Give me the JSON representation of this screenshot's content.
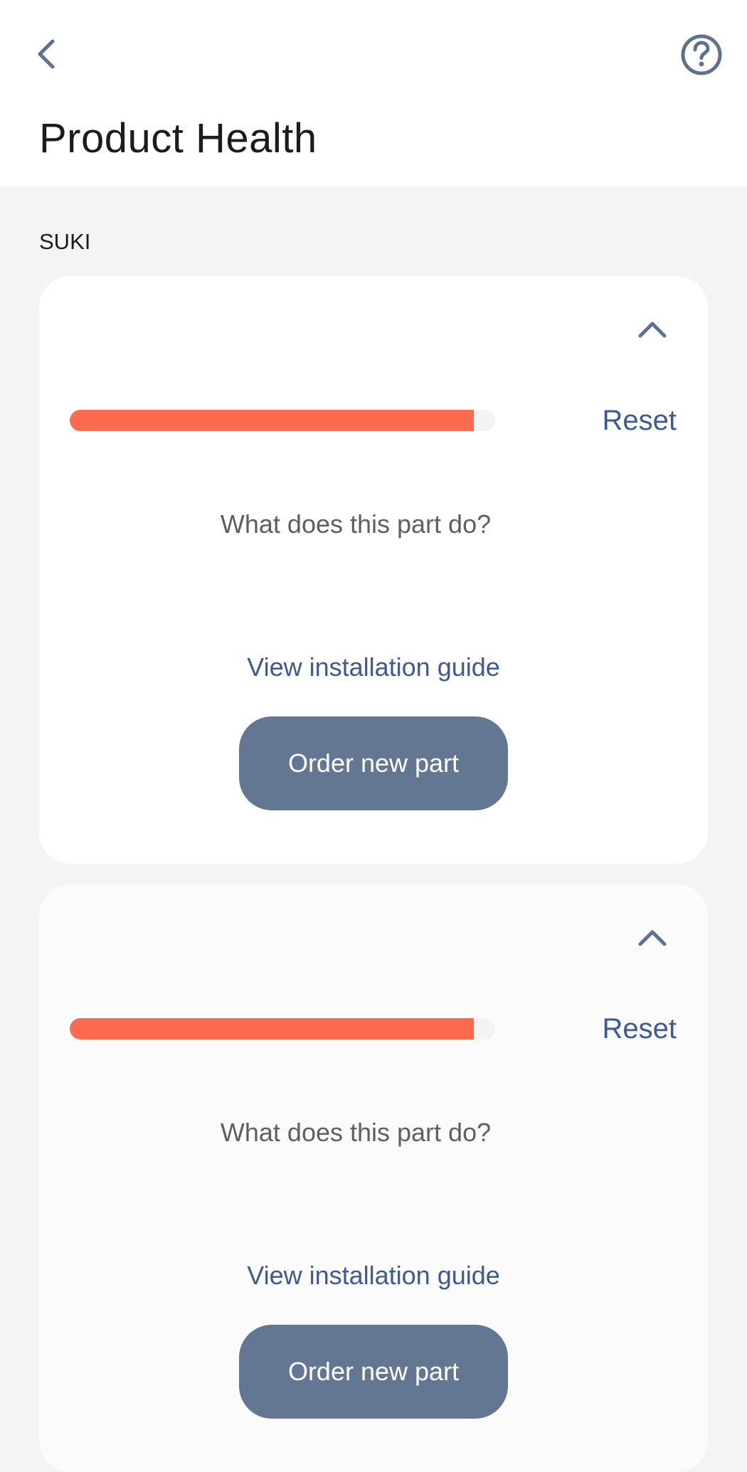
{
  "header": {
    "title": "Product Health",
    "back_icon": "chevron-left-icon",
    "help_icon": "question-circle-icon"
  },
  "device": {
    "name": "SUKI"
  },
  "parts": [
    {
      "collapse_icon": "chevron-up-icon",
      "progress_percent": 95,
      "reset_label": "Reset",
      "question": "What does this part do?",
      "guide_label": "View installation guide",
      "order_label": "Order new part"
    },
    {
      "collapse_icon": "chevron-up-icon",
      "progress_percent": 95,
      "reset_label": "Reset",
      "question": "What does this part do?",
      "guide_label": "View installation guide",
      "order_label": "Order new part"
    }
  ],
  "colors": {
    "accent": "#3d5a98",
    "progress": "#fd6b4e",
    "button": "#637792",
    "icon": "#5e7190"
  }
}
